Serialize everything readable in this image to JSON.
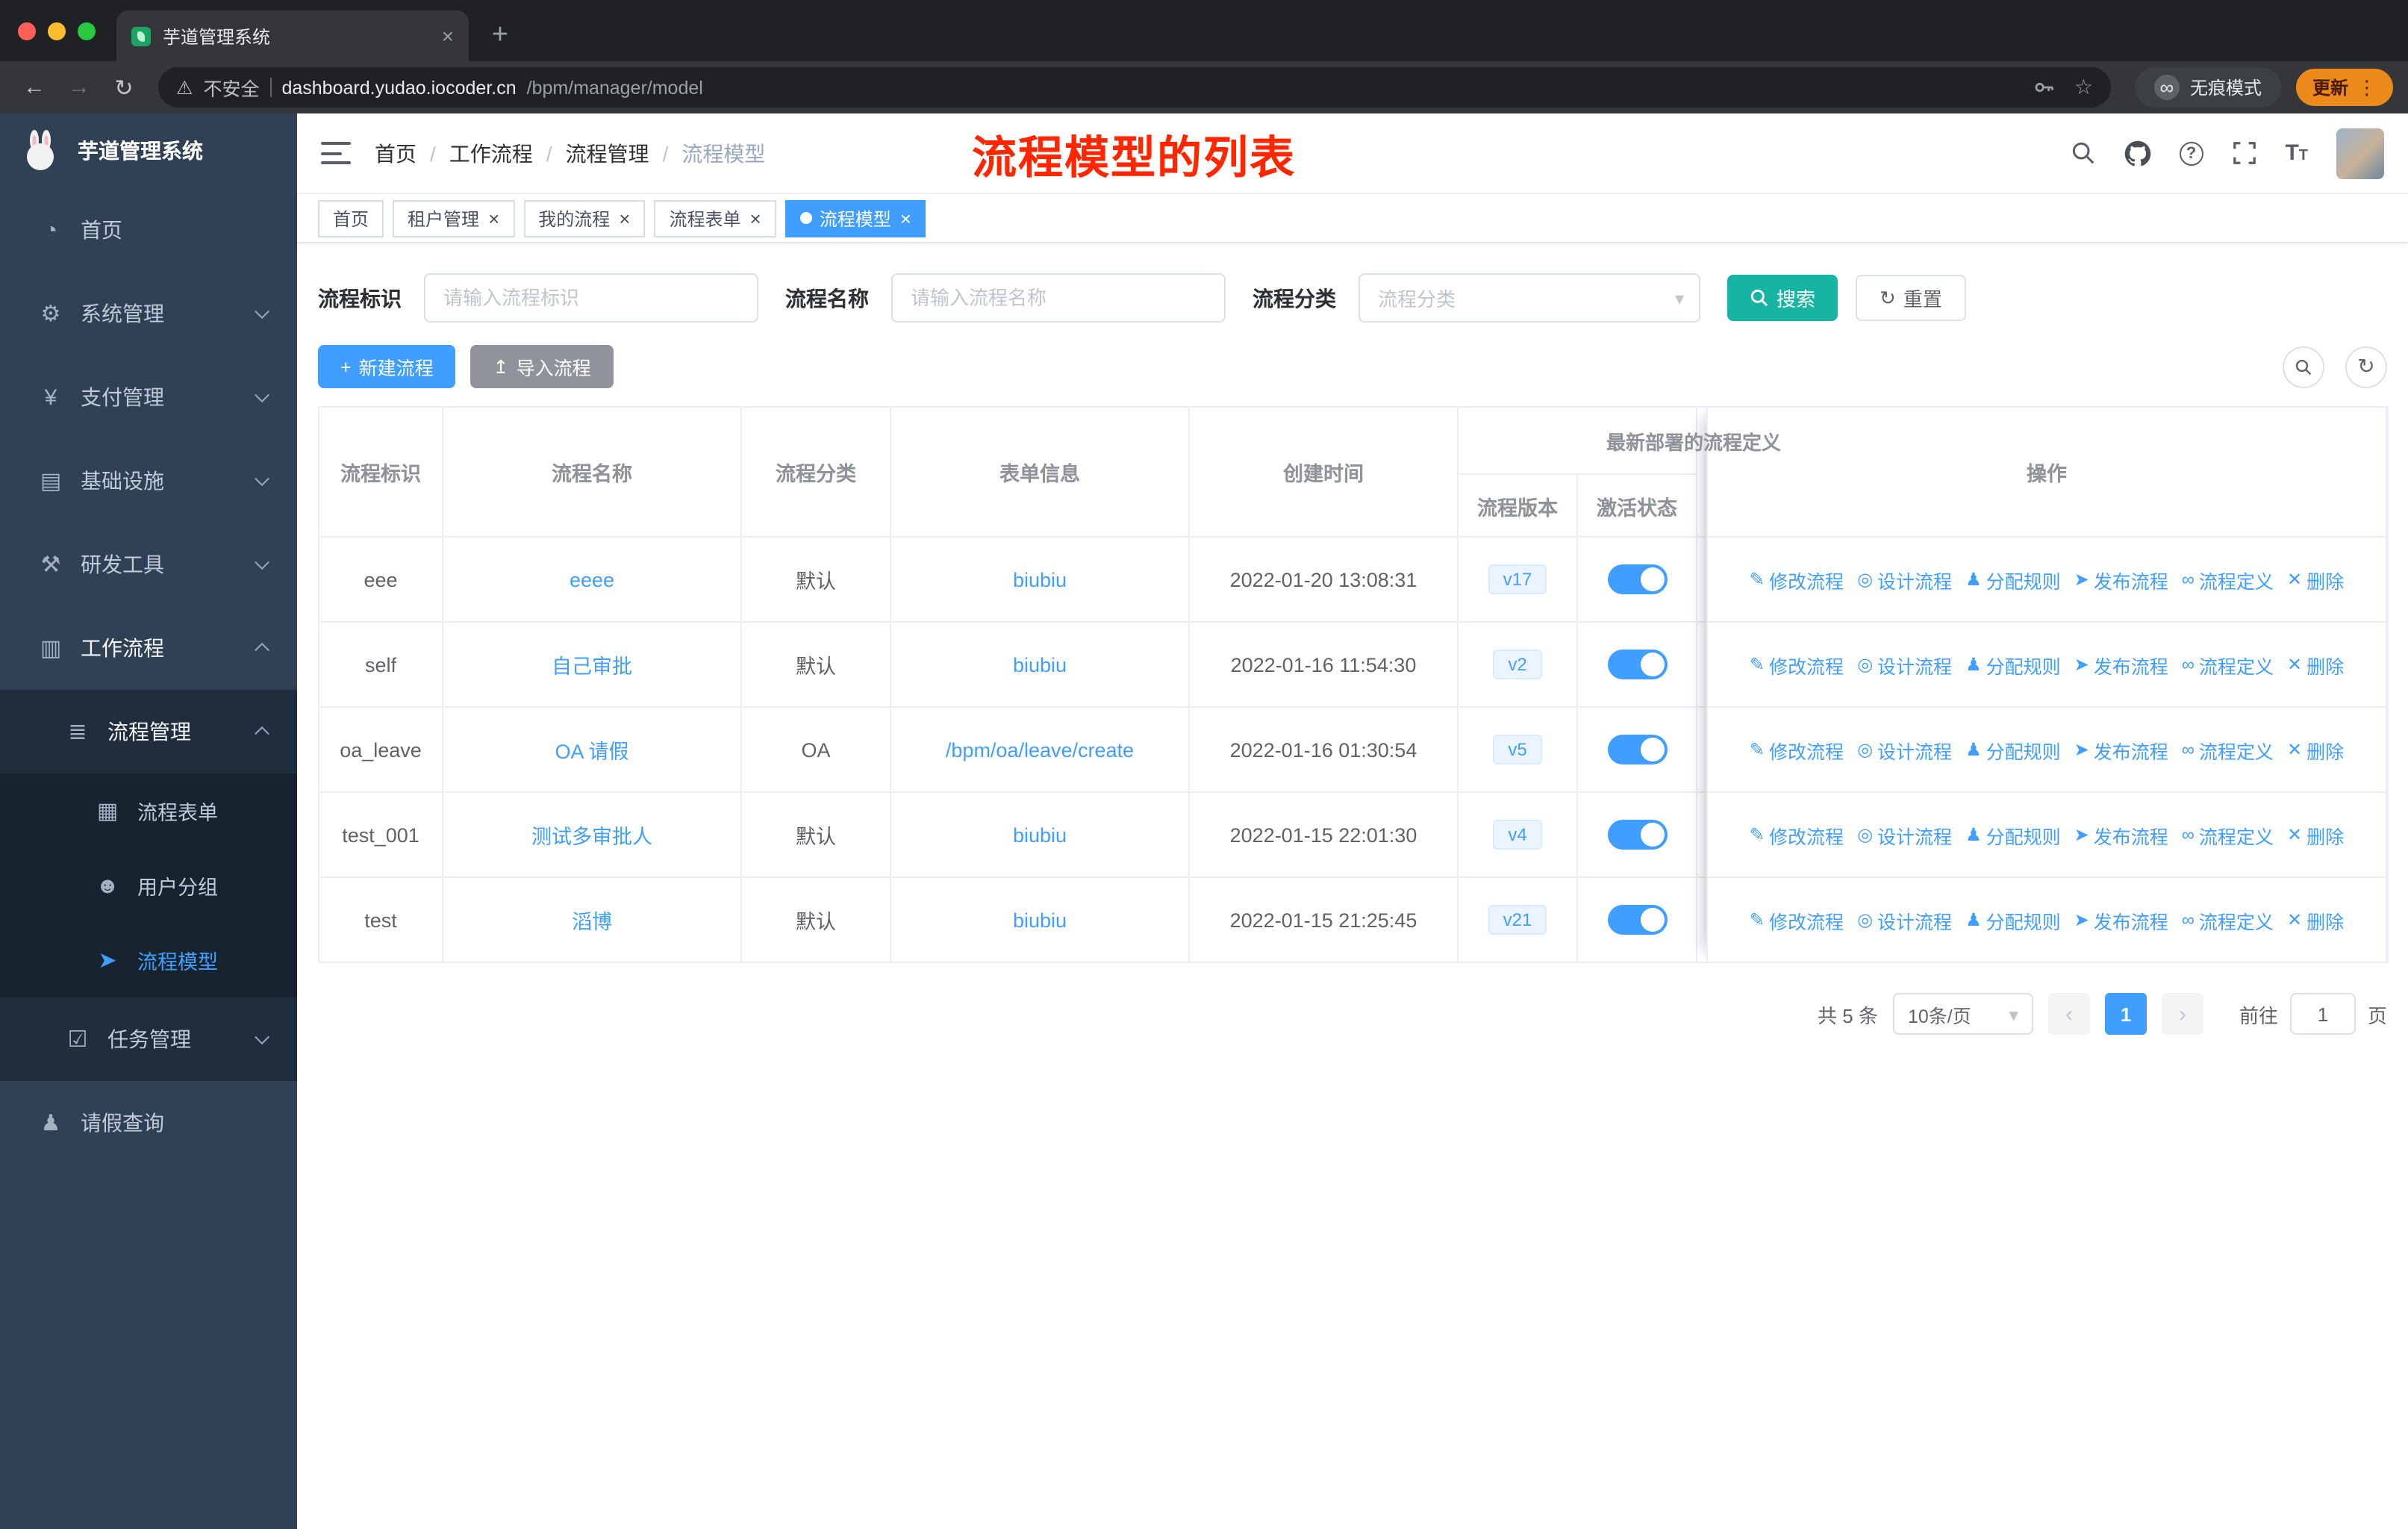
{
  "colors": {
    "primary": "#409eff",
    "search_button": "#17b3a3",
    "annotation_red": "#ff2600",
    "sidebar_bg": "#304156",
    "toggle_on": "#409eff",
    "update_chip": "#ed8a1c"
  },
  "browser": {
    "tab_title": "芋道管理系统",
    "security_label": "不安全",
    "url_host": "dashboard.yudao.iocoder.cn",
    "url_path": "/bpm/manager/model",
    "incognito_label": "无痕模式",
    "update_label": "更新"
  },
  "icons": {
    "close": "×",
    "plus": "+",
    "back": "←",
    "forward": "→",
    "reload": "↻",
    "warning": "⚠",
    "star": "☆",
    "dots": "⋮",
    "incognito": "∞",
    "caret_down": "▾",
    "chev_left": "‹",
    "chev_right": "›",
    "slash": "/",
    "upload": "↥",
    "refresh": "↻",
    "help": "?"
  },
  "menu_icons": {
    "home": "◔",
    "system": "⚙",
    "payment": "¥",
    "infra": "▤",
    "devtools": "⚒",
    "workflow": "▥",
    "process_mgmt": "≣",
    "process_form": "▦",
    "user_group": "☻",
    "process_model": "➤",
    "task_mgmt": "☑",
    "leave_query": "♟"
  },
  "sidebar": {
    "app_title": "芋道管理系统",
    "items": {
      "home": "首页",
      "system": "系统管理",
      "payment": "支付管理",
      "infra": "基础设施",
      "devtools": "研发工具",
      "workflow": "工作流程",
      "process_mgmt": "流程管理",
      "process_form": "流程表单",
      "user_group": "用户分组",
      "process_model": "流程模型",
      "task_mgmt": "任务管理",
      "leave_query": "请假查询"
    }
  },
  "navbar": {
    "breadcrumb": [
      "首页",
      "工作流程",
      "流程管理",
      "流程模型"
    ],
    "annotation": "流程模型的列表"
  },
  "tags": [
    {
      "label": "首页"
    },
    {
      "label": "租户管理"
    },
    {
      "label": "我的流程"
    },
    {
      "label": "流程表单"
    },
    {
      "label": "流程模型"
    }
  ],
  "filters": {
    "key_label": "流程标识",
    "key_placeholder": "请输入流程标识",
    "name_label": "流程名称",
    "name_placeholder": "请输入流程名称",
    "category_label": "流程分类",
    "category_placeholder": "流程分类",
    "search_button": "搜索",
    "reset_button": "重置"
  },
  "actions_bar": {
    "create_button": "新建流程",
    "import_button": "导入流程"
  },
  "table": {
    "headers": {
      "id": "流程标识",
      "name": "流程名称",
      "category": "流程分类",
      "form": "表单信息",
      "created": "创建时间",
      "deploy_group": "最新部署的流程定义",
      "version": "流程版本",
      "status": "激活状态",
      "actions": "操作"
    },
    "rows": [
      {
        "id": "eee",
        "name": "eeee",
        "category": "默认",
        "form": "biubiu",
        "created": "2022-01-20 13:08:31",
        "version": "v17",
        "active": true
      },
      {
        "id": "self",
        "name": "自己审批",
        "category": "默认",
        "form": "biubiu",
        "created": "2022-01-16 11:54:30",
        "version": "v2",
        "active": true
      },
      {
        "id": "oa_leave",
        "name": "OA 请假",
        "category": "OA",
        "form": "/bpm/oa/leave/create",
        "created": "2022-01-16 01:30:54",
        "version": "v5",
        "active": true
      },
      {
        "id": "test_001",
        "name": "测试多审批人",
        "category": "默认",
        "form": "biubiu",
        "created": "2022-01-15 22:01:30",
        "version": "v4",
        "active": true
      },
      {
        "id": "test",
        "name": "滔博",
        "category": "默认",
        "form": "biubiu",
        "created": "2022-01-15 21:25:45",
        "version": "v21",
        "active": true
      }
    ],
    "row_actions": [
      "修改流程",
      "设计流程",
      "分配规则",
      "发布流程",
      "流程定义",
      "删除"
    ],
    "action_icons": {
      "edit": "✎",
      "design": "◎",
      "assign": "♟",
      "publish": "➤",
      "definition": "∞",
      "delete": "✕"
    }
  },
  "pagination": {
    "total": "共 5 条",
    "page_size": "10条/页",
    "current": "1",
    "goto_prefix": "前往",
    "goto_value": "1",
    "goto_suffix": "页"
  }
}
